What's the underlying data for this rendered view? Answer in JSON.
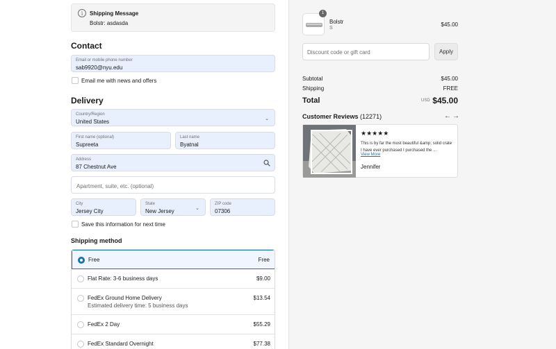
{
  "notice": {
    "title": "Shipping Message",
    "message": "Bolstr: asdasda",
    "icon": "info-icon"
  },
  "contact": {
    "heading": "Contact",
    "email_label": "Email or mobile phone number",
    "email_value": "sab9920@nyu.edu",
    "news_label": "Email me with news and offers"
  },
  "delivery": {
    "heading": "Delivery",
    "country_label": "Country/Region",
    "country_value": "United States",
    "first_label": "First name (optional)",
    "first_value": "Supreeta",
    "last_label": "Last name",
    "last_value": "Byatnal",
    "address_label": "Address",
    "address_value": "87 Chestnut Ave",
    "apt_placeholder": "Apartment, suite, etc. (optional)",
    "city_label": "City",
    "city_value": "Jersey City",
    "state_label": "State",
    "state_value": "New Jersey",
    "zip_label": "ZIP code",
    "zip_value": "07306",
    "save_label": "Save this information for next time"
  },
  "shipping": {
    "heading": "Shipping method",
    "options": [
      {
        "name": "Free",
        "sub": "",
        "price": "Free"
      },
      {
        "name": "Flat Rate: 3-6 business days",
        "sub": "",
        "price": "$9.00"
      },
      {
        "name": "FedEx Ground Home Delivery",
        "sub": "Estimated delivery time: 5 business days",
        "price": "$13.54"
      },
      {
        "name": "FedEx 2 Day",
        "sub": "",
        "price": "$55.29"
      },
      {
        "name": "FedEx Standard Overnight",
        "sub": "",
        "price": "$77.38"
      }
    ]
  },
  "cart": {
    "quantity": "1",
    "product_name": "Bolstr",
    "product_variant": "S",
    "product_price": "$45.00",
    "discount_placeholder": "Discount code or gift card",
    "apply_label": "Apply",
    "subtotal_label": "Subtotal",
    "subtotal_value": "$45.00",
    "shipping_label": "Shipping",
    "shipping_value": "FREE",
    "total_label": "Total",
    "currency": "USD",
    "total_value": "$45.00"
  },
  "reviews": {
    "title": "Customer Reviews",
    "count": "(12271)",
    "stars": "★★★★★",
    "text": "This is by far the most beautiful &amp; solid crate I have ever purchased I purchased the ...",
    "more": "View More",
    "author": "Jennifer"
  }
}
